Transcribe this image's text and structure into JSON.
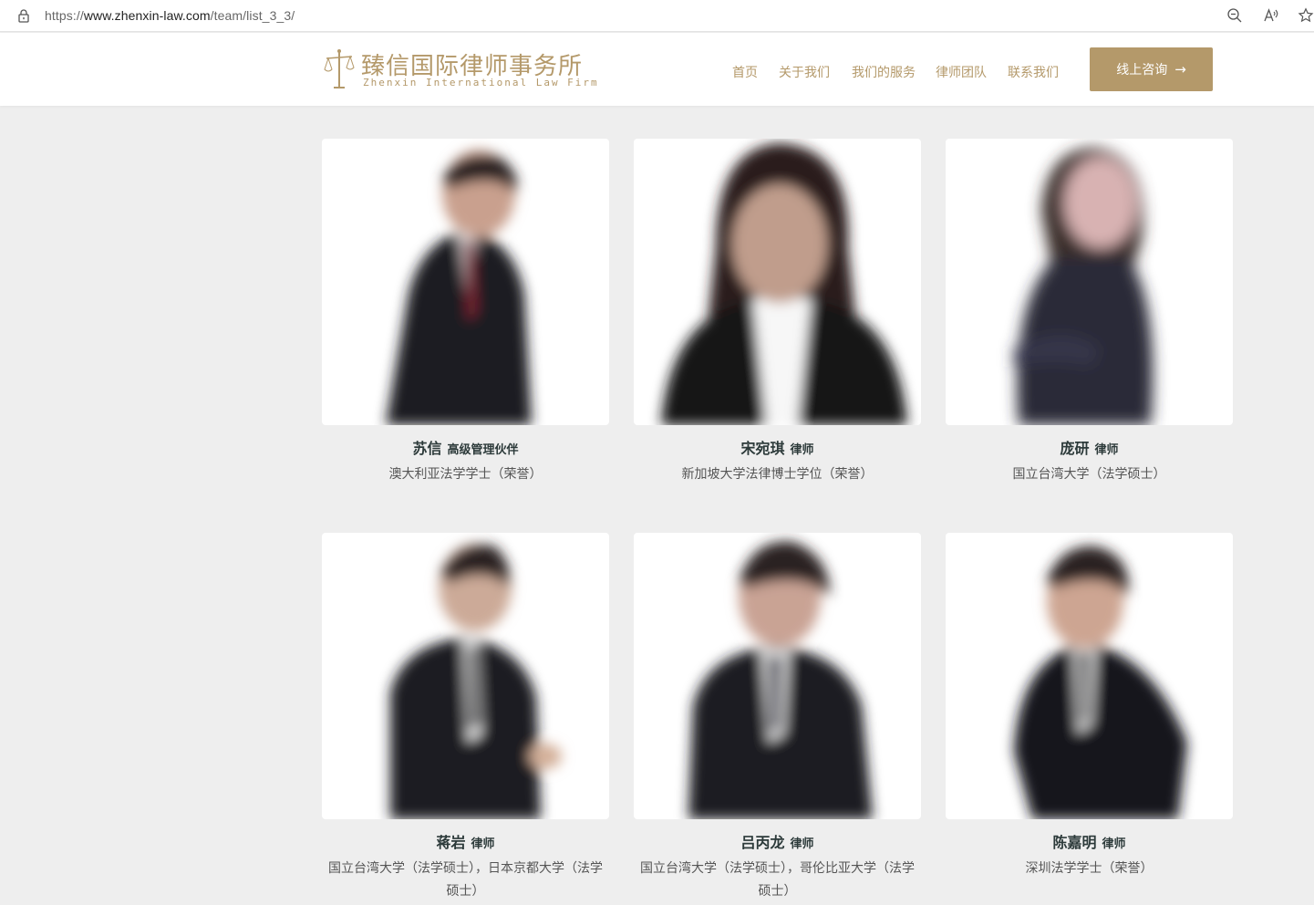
{
  "browser": {
    "url_prefix": "https://",
    "url_domain": "www.zhenxin-law.com",
    "url_path": "/team/list_3_3/",
    "icons": [
      "lock-icon",
      "zoom-out-icon",
      "read-aloud-icon",
      "favorite-star-icon"
    ]
  },
  "header": {
    "logo_cn": "臻信国际律师事务所",
    "logo_en": "Zhenxin International Law Firm",
    "nav": [
      "首页",
      "关于我们",
      "我们的服务",
      "律师团队",
      "联系我们"
    ],
    "cta_label": "线上咨询",
    "cta_arrow": "→"
  },
  "colors": {
    "accent": "#b4996a",
    "page_bg": "#eeeeee",
    "name_text": "#2c3a3a"
  },
  "team": [
    {
      "name": "苏信",
      "title": "高级管理伙伴",
      "edu": "澳大利亚法学学士（荣誉）"
    },
    {
      "name": "宋宛琪",
      "title": "律师",
      "edu": "新加坡大学法律博士学位（荣誉）"
    },
    {
      "name": "庞研",
      "title": "律师",
      "edu": "国立台湾大学（法学硕士）"
    },
    {
      "name": "蒋岩",
      "title": "律师",
      "edu": "国立台湾大学（法学硕士），日本京都大学（法学硕士）"
    },
    {
      "name": "吕丙龙",
      "title": "律师",
      "edu": "国立台湾大学（法学硕士），哥伦比亚大学（法学硕士）"
    },
    {
      "name": "陈嘉明",
      "title": "律师",
      "edu": "深圳法学学士（荣誉）"
    }
  ]
}
